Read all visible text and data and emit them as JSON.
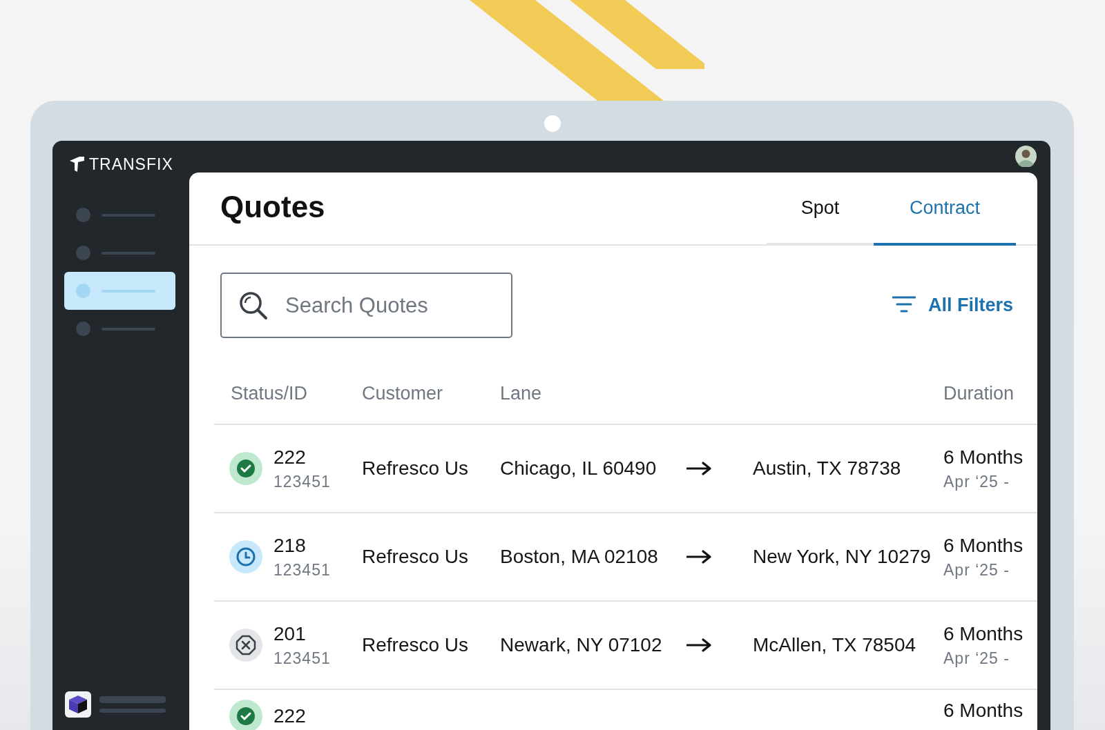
{
  "app": {
    "logo": "TRANSFIX"
  },
  "sidebar": {
    "items": [
      {
        "selected": false
      },
      {
        "selected": false
      },
      {
        "selected": true
      },
      {
        "selected": false
      }
    ]
  },
  "page": {
    "title": "Quotes"
  },
  "tabs": [
    {
      "label": "Spot",
      "selected": false
    },
    {
      "label": "Contract",
      "selected": true
    }
  ],
  "search": {
    "placeholder": "Search Quotes"
  },
  "filters": {
    "label": "All Filters"
  },
  "table": {
    "columns": [
      "Status/ID",
      "Customer",
      "Lane",
      "Duration"
    ],
    "rows": [
      {
        "kind": "accepted",
        "id": "222",
        "ref": "123451",
        "customer": "Refresco Us",
        "origin": "Chicago, IL 60490",
        "destination": "Austin, TX 78738",
        "duration": "6 Months",
        "dates": "Apr ‘25 -"
      },
      {
        "kind": "pending",
        "id": "218",
        "ref": "123451",
        "customer": "Refresco Us",
        "origin": "Boston, MA 02108",
        "destination": "New York, NY 10279",
        "duration": "6 Months",
        "dates": "Apr ‘25 -"
      },
      {
        "kind": "declined",
        "id": "201",
        "ref": "123451",
        "customer": "Refresco Us",
        "origin": "Newark, NY 07102",
        "destination": "McAllen, TX 78504",
        "duration": "6 Months",
        "dates": "Apr ‘25 -"
      },
      {
        "kind": "accepted",
        "id": "222",
        "duration": "6 Months"
      }
    ]
  }
}
